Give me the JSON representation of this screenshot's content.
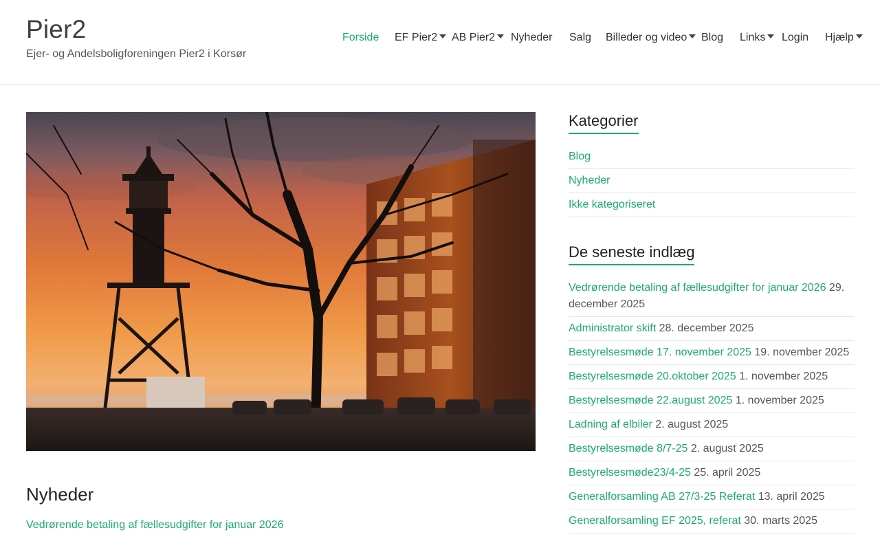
{
  "site": {
    "title": "Pier2",
    "tagline": "Ejer- og Andelsboligforeningen Pier2 i Korsør"
  },
  "nav": {
    "items": [
      {
        "label": "Forside",
        "active": true,
        "has_submenu": false
      },
      {
        "label": "EF Pier2",
        "active": false,
        "has_submenu": true
      },
      {
        "label": "AB Pier2",
        "active": false,
        "has_submenu": true
      },
      {
        "label": "Nyheder",
        "active": false,
        "has_submenu": false
      },
      {
        "label": "Salg",
        "active": false,
        "has_submenu": false
      },
      {
        "label": "Billeder og video",
        "active": false,
        "has_submenu": true
      },
      {
        "label": "Blog",
        "active": false,
        "has_submenu": false
      },
      {
        "label": "Links",
        "active": false,
        "has_submenu": true
      },
      {
        "label": "Login",
        "active": false,
        "has_submenu": false
      },
      {
        "label": "Hjælp",
        "active": false,
        "has_submenu": true
      }
    ]
  },
  "main": {
    "section_title": "Nyheder",
    "first_post_link": "Vedrørende betaling af fællesudgifter for januar 2026"
  },
  "sidebar": {
    "categories": {
      "title": "Kategorier",
      "items": [
        "Blog",
        "Nyheder",
        "Ikke kategoriseret"
      ]
    },
    "recent": {
      "title": "De seneste indlæg",
      "items": [
        {
          "title": "Vedrørende betaling af fællesudgifter for januar 2026",
          "date": "29. december 2025"
        },
        {
          "title": "Administrator skift",
          "date": "28. december 2025"
        },
        {
          "title": "Bestyrelsesmøde 17. november 2025",
          "date": "19. november 2025"
        },
        {
          "title": "Bestyrelsesmøde 20.oktober 2025",
          "date": "1. november 2025"
        },
        {
          "title": "Bestyrelsesmøde 22.august 2025",
          "date": "1. november 2025"
        },
        {
          "title": "Ladning af elbiler",
          "date": "2. august 2025"
        },
        {
          "title": "Bestyrelsesmøde 8/7-25",
          "date": "2. august 2025"
        },
        {
          "title": "Bestyrelsesmøde23/4-25",
          "date": "25. april 2025"
        },
        {
          "title": "Generalforsamling AB 27/3-25 Referat",
          "date": "13. april 2025"
        },
        {
          "title": "Generalforsamling EF 2025, referat",
          "date": "30. marts 2025"
        }
      ]
    }
  },
  "colors": {
    "accent": "#1dab6c",
    "text": "#444444",
    "divider": "#e6e6e6"
  }
}
